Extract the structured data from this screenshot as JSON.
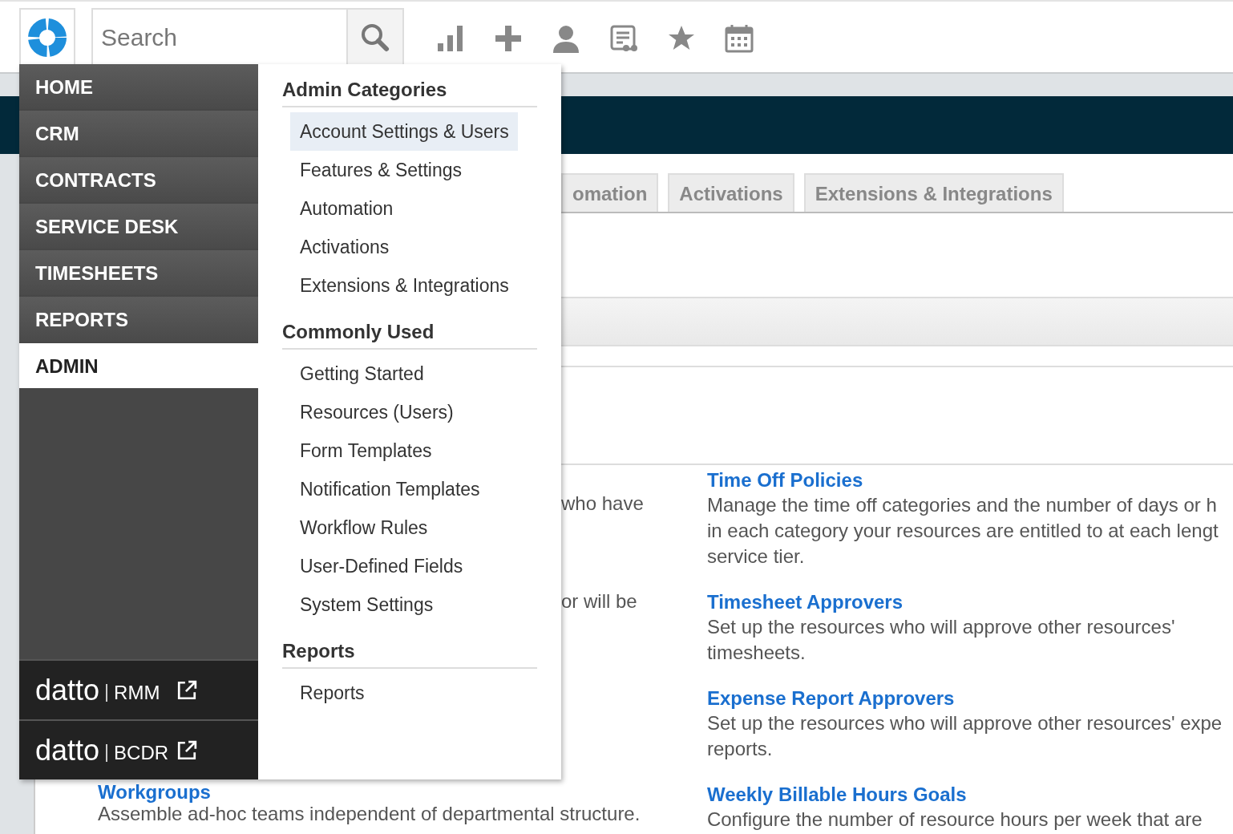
{
  "toolbar": {
    "search": {
      "placeholder": "Search"
    }
  },
  "tabs": [
    {
      "label": "omation",
      "selected": false
    },
    {
      "label": "Activations",
      "selected": false
    },
    {
      "label": "Extensions & Integrations",
      "selected": false
    }
  ],
  "left_column": [
    {
      "kind": "text",
      "text": "who have"
    },
    {
      "kind": "text",
      "text": "or will be"
    },
    {
      "kind": "entry",
      "title": "Workgroups",
      "description": "Assemble ad-hoc teams independent of departmental structure."
    }
  ],
  "right_column": [
    {
      "title": "Time Off Policies",
      "description": [
        "Manage the time off categories and the number of days or h",
        "in each category your resources are entitled to at each lengt",
        "service tier."
      ]
    },
    {
      "title": "Timesheet Approvers",
      "description": [
        "Set up the resources who will approve other resources'",
        "timesheets."
      ]
    },
    {
      "title": "Expense Report Approvers",
      "description": [
        "Set up the resources who will approve other resources' expe",
        "reports."
      ]
    },
    {
      "title": "Weekly Billable Hours Goals",
      "description": [
        "Configure the number of resource hours per week that are"
      ]
    }
  ],
  "menu": {
    "nav": [
      {
        "label": "HOME",
        "selected": false
      },
      {
        "label": "CRM",
        "selected": false
      },
      {
        "label": "CONTRACTS",
        "selected": false
      },
      {
        "label": "SERVICE DESK",
        "selected": false
      },
      {
        "label": "TIMESHEETS",
        "selected": false
      },
      {
        "label": "REPORTS",
        "selected": false
      },
      {
        "label": "ADMIN",
        "selected": true
      }
    ],
    "products": [
      {
        "brand": "datto",
        "product": "RMM"
      },
      {
        "brand": "datto",
        "product": "BCDR"
      }
    ],
    "sections": [
      {
        "title": "Admin Categories",
        "items": [
          {
            "label": "Account Settings & Users",
            "selected": true
          },
          {
            "label": "Features & Settings",
            "selected": false
          },
          {
            "label": "Automation",
            "selected": false
          },
          {
            "label": "Activations",
            "selected": false
          },
          {
            "label": "Extensions & Integrations",
            "selected": false
          }
        ]
      },
      {
        "title": "Commonly Used",
        "items": [
          {
            "label": "Getting Started",
            "selected": false
          },
          {
            "label": "Resources (Users)",
            "selected": false
          },
          {
            "label": "Form Templates",
            "selected": false
          },
          {
            "label": "Notification Templates",
            "selected": false
          },
          {
            "label": "Workflow Rules",
            "selected": false
          },
          {
            "label": "User-Defined Fields",
            "selected": false
          },
          {
            "label": "System Settings",
            "selected": false
          }
        ]
      },
      {
        "title": "Reports",
        "items": [
          {
            "label": "Reports",
            "selected": false
          }
        ]
      }
    ]
  }
}
